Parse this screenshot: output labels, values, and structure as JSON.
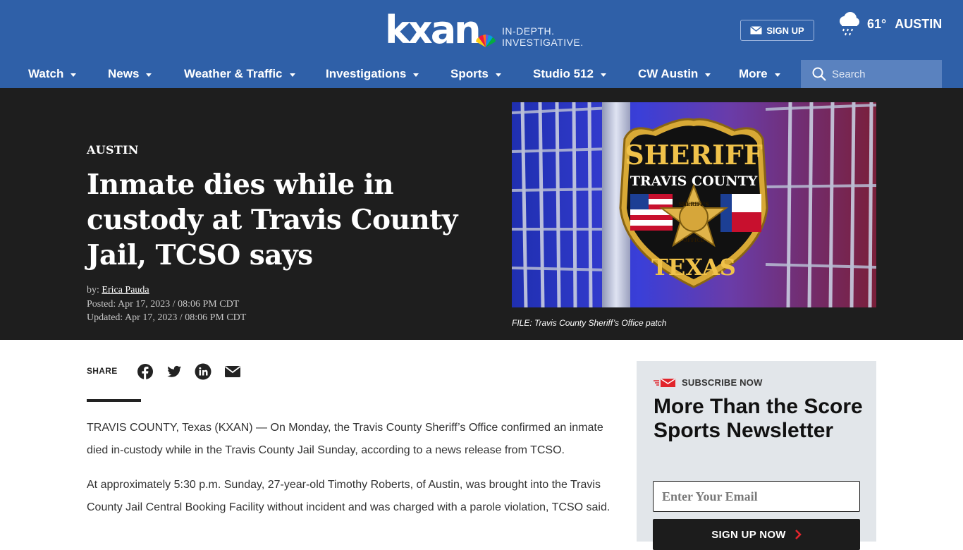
{
  "brand": {
    "logo_text": "kxan",
    "tagline_line1": "IN-DEPTH.",
    "tagline_line2": "INVESTIGATIVE."
  },
  "header": {
    "signup_label": "SIGN UP",
    "weather_temp": "61°",
    "weather_city": "AUSTIN",
    "weather_icon": "rain-cloud-icon"
  },
  "nav": {
    "items": [
      {
        "label": "Watch"
      },
      {
        "label": "News"
      },
      {
        "label": "Weather & Traffic"
      },
      {
        "label": "Investigations"
      },
      {
        "label": "Sports"
      },
      {
        "label": "Studio 512"
      },
      {
        "label": "CW Austin"
      },
      {
        "label": "More"
      }
    ],
    "search_placeholder": "Search"
  },
  "article": {
    "kicker": "AUSTIN",
    "headline": "Inmate dies while in custody at Travis County Jail, TCSO says",
    "byline_prefix": "by: ",
    "author": "Erica Pauda",
    "posted": "Posted: Apr 17, 2023 / 08:06 PM CDT",
    "updated": "Updated: Apr 17, 2023 / 08:06 PM CDT",
    "image_badge_top": "SHERIFF",
    "image_badge_arc": "TRAVIS COUNTY",
    "image_badge_bottom": "TEXAS",
    "image_star_text": "SHERIFF'S",
    "image_star_text2": "OFFICE",
    "image_caption": "FILE: Travis County Sheriff’s Office patch",
    "share_label": "SHARE",
    "share_icons": [
      "facebook-icon",
      "twitter-icon",
      "linkedin-icon",
      "email-icon"
    ],
    "paragraphs": [
      "TRAVIS COUNTY, Texas (KXAN) — On Monday, the Travis County Sheriff’s Office confirmed an inmate died in-custody while in the Travis County Jail Sunday, according to a news release from TCSO.",
      "At approximately 5:30 p.m. Sunday, 27-year-old Timothy Roberts, of Austin, was brought into the Travis County Jail Central Booking Facility without incident and was charged with a parole violation, TCSO said."
    ]
  },
  "promo": {
    "kicker": "SUBSCRIBE NOW",
    "title": "More Than the Score Sports Newsletter",
    "email_placeholder": "Enter Your Email",
    "button_label": "SIGN UP NOW"
  },
  "colors": {
    "header_blue": "#2f60a8",
    "search_bg": "#5a82bf",
    "hero_bg": "#1e1e1e",
    "promo_bg": "#e2e6ea",
    "accent_red": "#e1252c"
  }
}
